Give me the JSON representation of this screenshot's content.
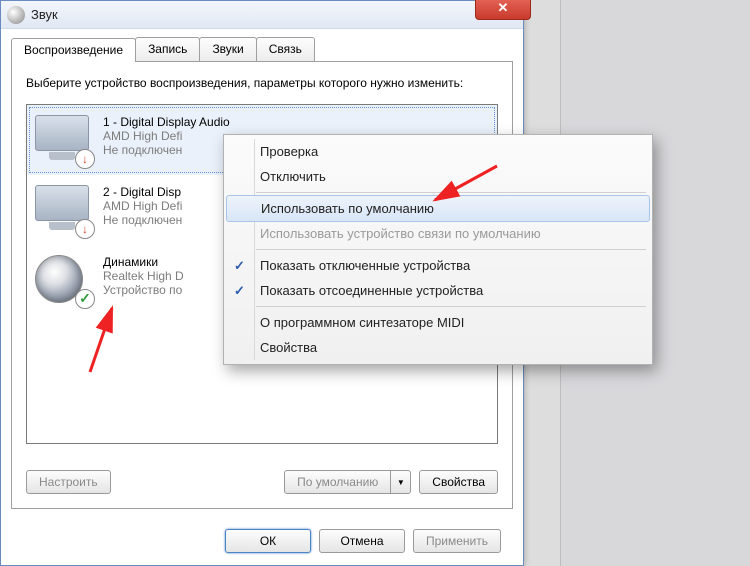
{
  "window": {
    "title": "Звук",
    "close_glyph": "✕"
  },
  "tabs": {
    "playback": "Воспроизведение",
    "recording": "Запись",
    "sounds": "Звуки",
    "communications": "Связь"
  },
  "instruction": "Выберите устройство воспроизведения, параметры которого нужно изменить:",
  "devices": [
    {
      "name": "1 - Digital Display Audio",
      "desc": "AMD High Defi",
      "status": "Не подключен",
      "icon": "monitor",
      "badge": "down"
    },
    {
      "name": "2 - Digital Disp",
      "desc": "AMD High Defi",
      "status": "Не подключен",
      "icon": "monitor",
      "badge": "down"
    },
    {
      "name": "Динамики",
      "desc": "Realtek High D",
      "status": "Устройство по",
      "icon": "speaker",
      "badge": "ok"
    }
  ],
  "panel_buttons": {
    "configure": "Настроить",
    "default": "По умолчанию",
    "properties": "Свойства"
  },
  "dialog_buttons": {
    "ok": "ОК",
    "cancel": "Отмена",
    "apply": "Применить"
  },
  "context_menu": {
    "test": "Проверка",
    "disable": "Отключить",
    "set_default": "Использовать по умолчанию",
    "set_comm_default": "Использовать устройство связи по умолчанию",
    "show_disabled": "Показать отключенные устройства",
    "show_disconnected": "Показать отсоединенные устройства",
    "about_synth": "О программном синтезаторе MIDI",
    "properties": "Свойства",
    "check_glyph": "✓"
  }
}
